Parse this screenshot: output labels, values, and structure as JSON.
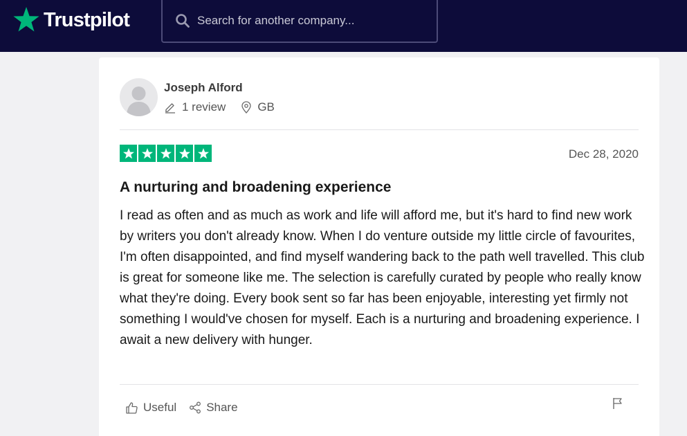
{
  "header": {
    "logo_text": "Trustpilot",
    "search": {
      "placeholder": "Search for another company..."
    }
  },
  "review": {
    "reviewer": {
      "name": "Joseph Alford",
      "review_count": "1 review",
      "country": "GB"
    },
    "rating": 5,
    "rating_max": 5,
    "date": "Dec 28, 2020",
    "title": "A nurturing and broadening experience",
    "body": "I read as often and as much as work and life will afford me, but it's hard to find new work by writers you don't already know. When I do venture outside my little circle of favourites, I'm often disappointed, and find myself wandering back to the path well travelled. This club is great for someone like me. The selection is carefully curated by people who really know what they're doing. Every book sent so far has been enjoyable, interesting yet firmly not something I would've chosen for myself. Each is a nurturing and broadening experience. I await a new delivery with hunger.",
    "actions": {
      "useful": "Useful",
      "share": "Share"
    }
  },
  "colors": {
    "header_bg": "#0d0c3a",
    "brand_green": "#00b67a",
    "page_bg": "#f1f1f3"
  }
}
